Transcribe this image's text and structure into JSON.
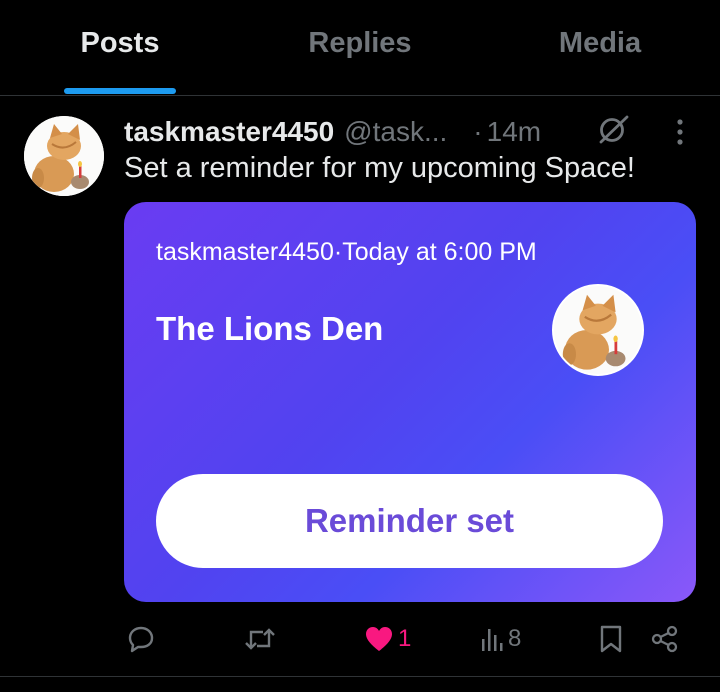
{
  "tabs": [
    {
      "label": "Posts",
      "active": true
    },
    {
      "label": "Replies",
      "active": false
    },
    {
      "label": "Media",
      "active": false
    }
  ],
  "post": {
    "display_name": "taskmaster4450",
    "handle": "@task...",
    "separator": "·",
    "time": "14m",
    "text": "Set a reminder for my upcoming Space!"
  },
  "space_card": {
    "host": "taskmaster4450",
    "meta_separator": "·",
    "schedule": "Today at 6:00 PM",
    "title": "The Lions Den",
    "button_label": "Reminder set"
  },
  "actions": {
    "replies": "",
    "reposts": "",
    "likes": "1",
    "views": "8"
  },
  "colors": {
    "background": "#000000",
    "accent": "#1d9bf0",
    "like": "#f91880",
    "card_gradient_start": "#6a3cf2",
    "card_gradient_end": "#8a58f9",
    "button_text": "#6a4bd8"
  }
}
